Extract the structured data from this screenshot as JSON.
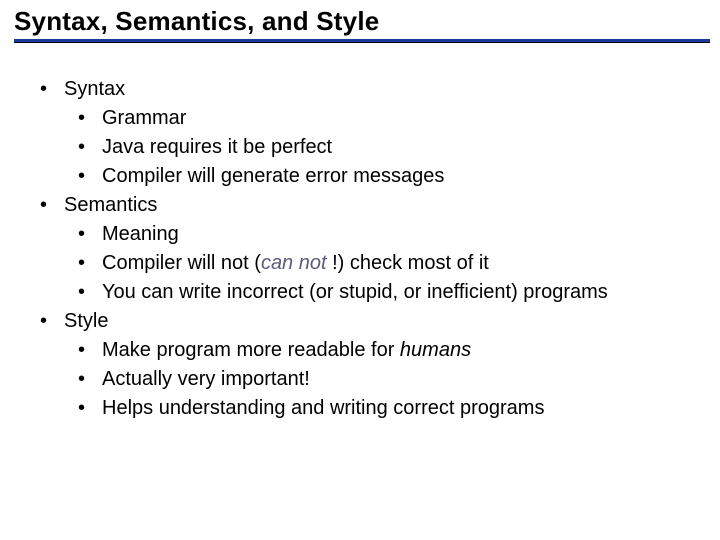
{
  "title": "Syntax, Semantics, and Style",
  "items": [
    {
      "label": "Syntax",
      "children": [
        {
          "label": "Grammar"
        },
        {
          "label": "Java requires it be perfect"
        },
        {
          "label": "Compiler will generate error messages"
        }
      ]
    },
    {
      "label": "Semantics",
      "children": [
        {
          "label": "Meaning"
        },
        {
          "prefix": "Compiler will not  (",
          "emph": "can not ",
          "suffix": "!) check most of it"
        },
        {
          "label": "You can write incorrect (or stupid, or inefficient) programs"
        }
      ]
    },
    {
      "label": "Style",
      "children": [
        {
          "prefix": "Make program more readable for ",
          "emph": "humans",
          "suffix": ""
        },
        {
          "label": "Actually very important!"
        },
        {
          "label": "Helps understanding and writing correct programs"
        }
      ]
    }
  ]
}
